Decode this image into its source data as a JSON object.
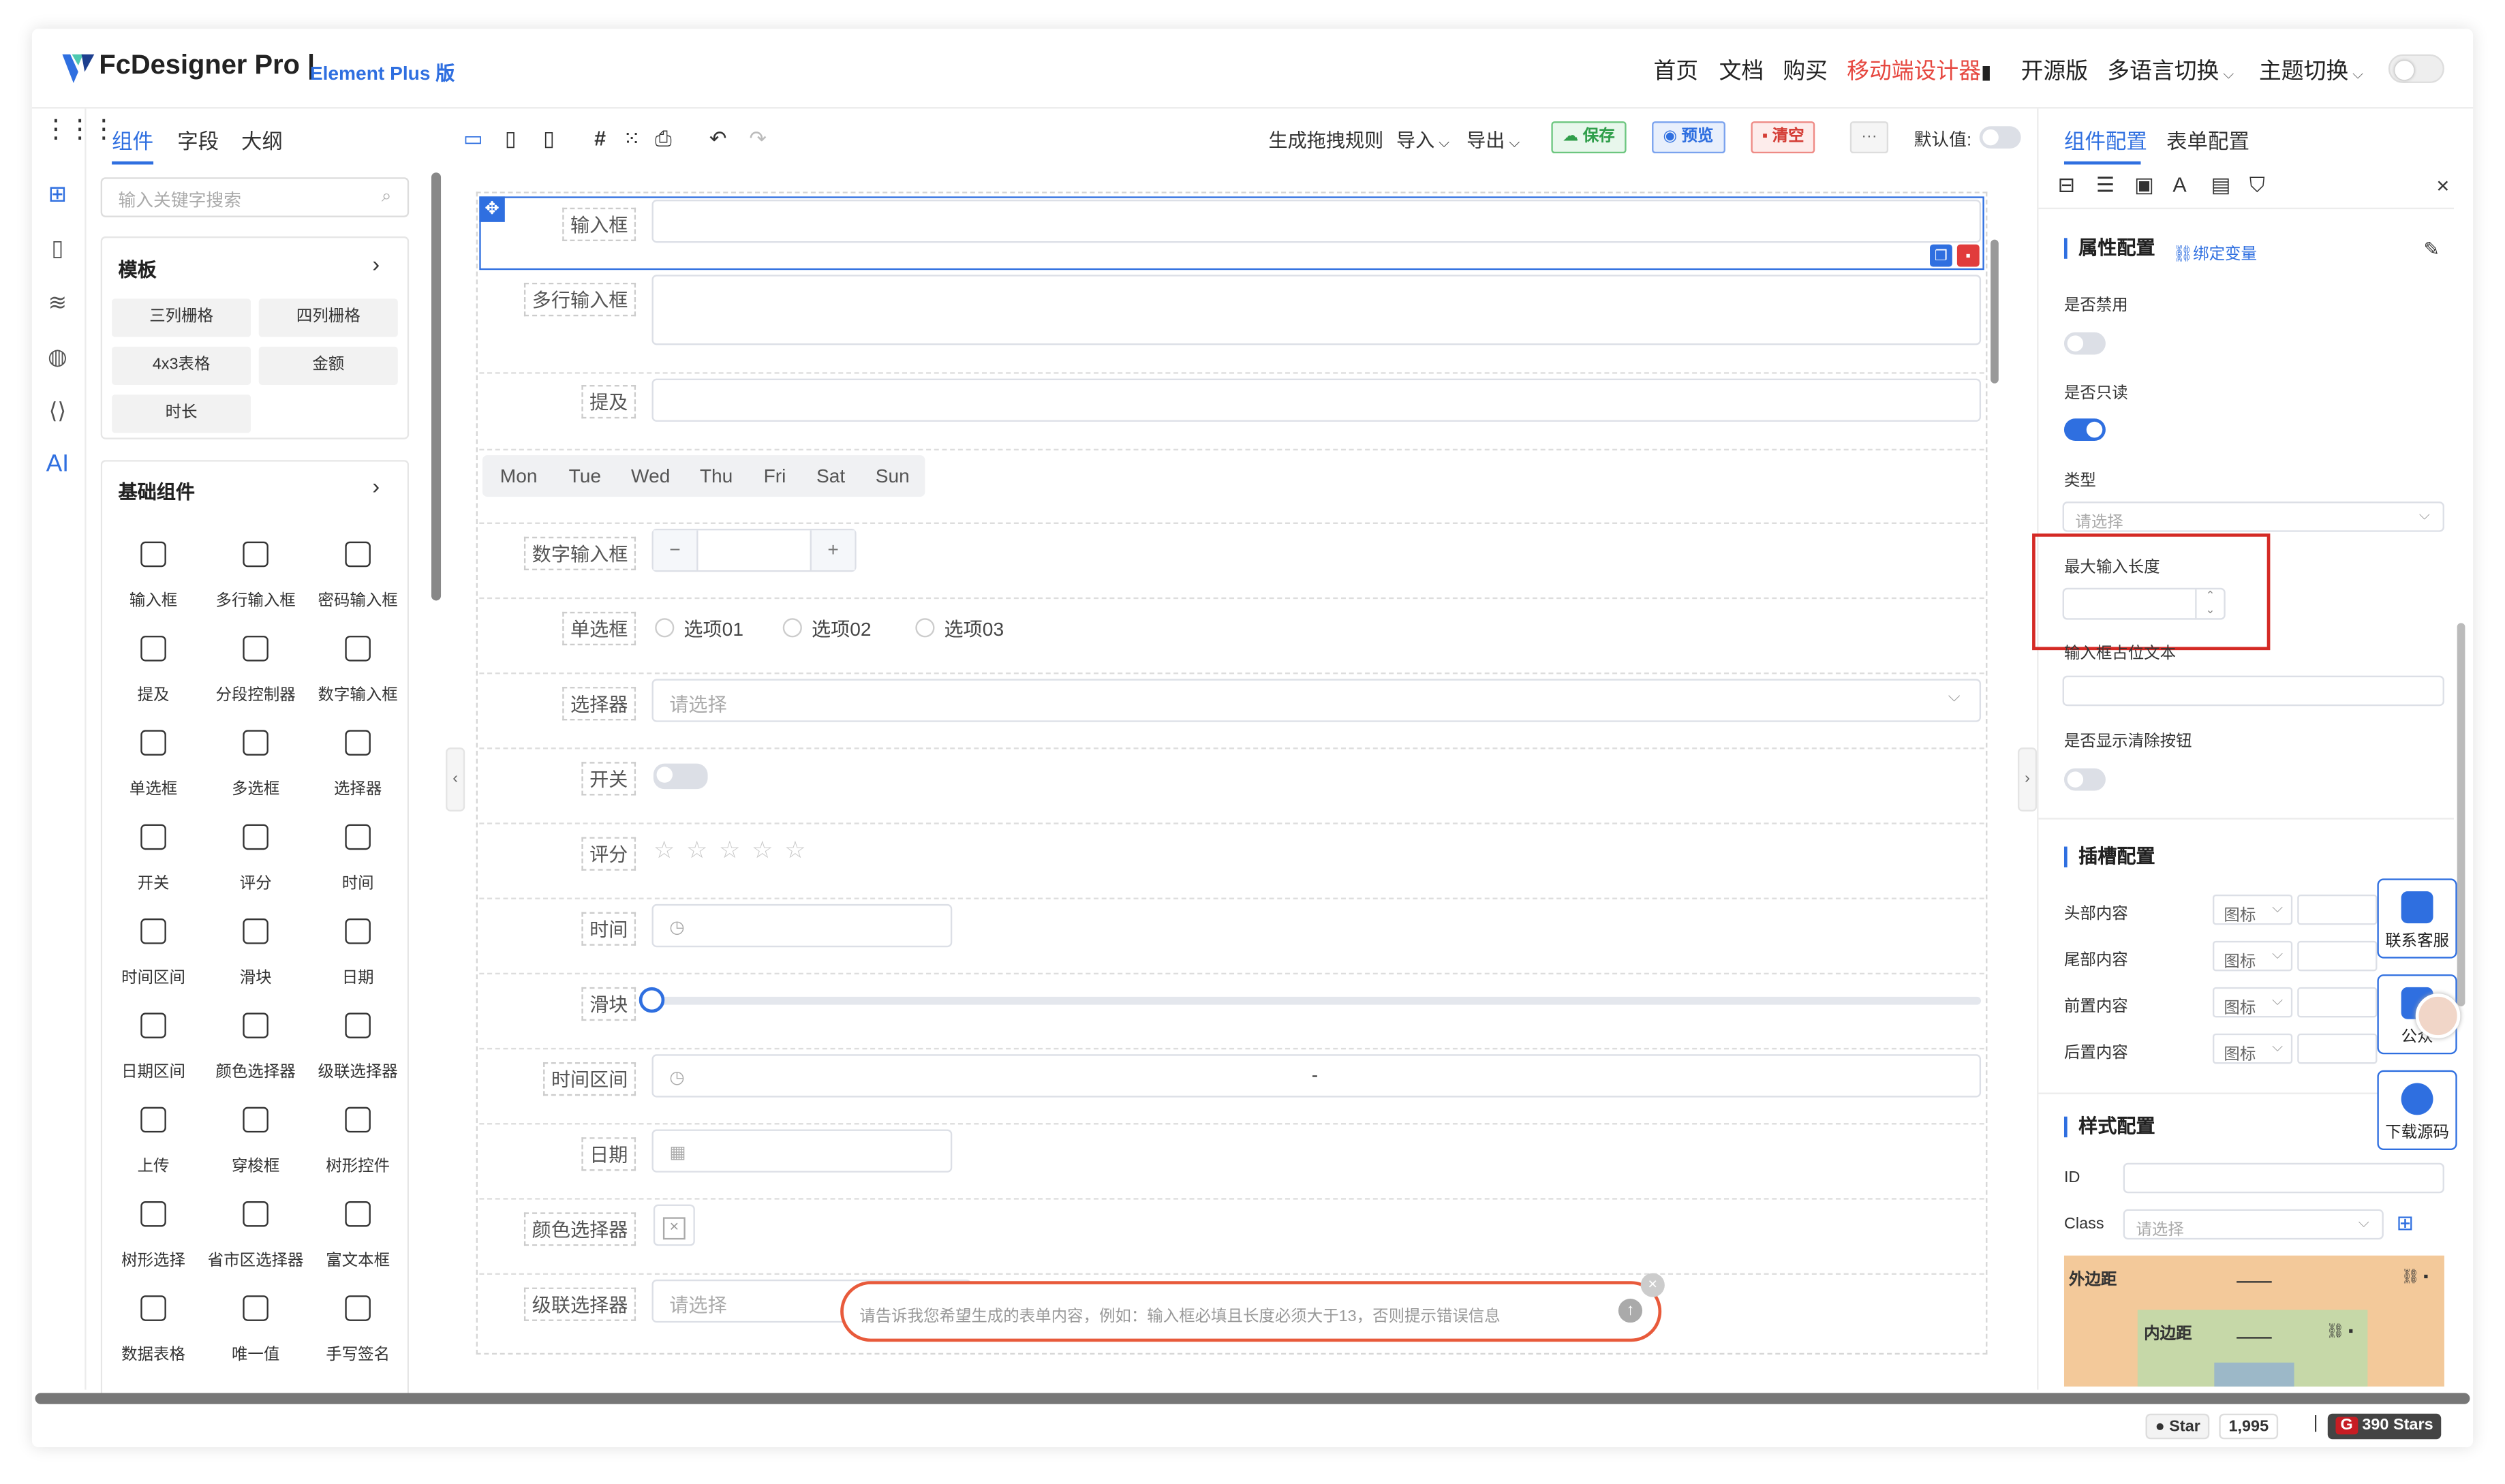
{
  "header": {
    "brand": "FcDesigner Pro |",
    "brand_sub": "Element Plus 版",
    "nav": [
      "首页",
      "文档",
      "购买",
      "移动端设计器",
      "开源版",
      "多语言切换",
      "主题切换"
    ],
    "nav_highlight": "#e6473f",
    "phone_glyph": "▮"
  },
  "left_panel": {
    "tabs": [
      "组件",
      "字段",
      "大纲"
    ],
    "search_placeholder": "输入关键字搜索",
    "templates_title": "模板",
    "templates": [
      "三列栅格",
      "四列栅格",
      "4x3表格",
      "金额",
      "时长"
    ],
    "basic_title": "基础组件",
    "components": [
      "输入框",
      "多行输入框",
      "密码输入框",
      "提及",
      "分段控制器",
      "数字输入框",
      "单选框",
      "多选框",
      "选择器",
      "开关",
      "评分",
      "时间",
      "时间区间",
      "滑块",
      "日期",
      "日期区间",
      "颜色选择器",
      "级联选择器",
      "上传",
      "穿梭框",
      "树形控件",
      "树形选择",
      "省市区选择器",
      "富文本框",
      "数据表格",
      "唯一值",
      "手写签名"
    ],
    "rail_ai": "AI"
  },
  "toolbar": {
    "rule": "生成拖拽规则",
    "import": "导入",
    "export": "导出",
    "save": "保存",
    "preview": "预览",
    "clear": "清空",
    "more": "···",
    "default_label": "默认值:"
  },
  "canvas": {
    "fields": {
      "input": "输入框",
      "textarea": "多行输入框",
      "mention": "提及",
      "number": "数字输入框",
      "radio": "单选框",
      "select": "选择器",
      "switch": "开关",
      "rate": "评分",
      "time": "时间",
      "slider": "滑块",
      "timerange": "时间区间",
      "date": "日期",
      "color": "颜色选择器",
      "cascader": "级联选择器"
    },
    "weekdays": [
      "Mon",
      "Tue",
      "Wed",
      "Thu",
      "Fri",
      "Sat",
      "Sun"
    ],
    "radio_options": [
      "选项01",
      "选项02",
      "选项03"
    ],
    "select_placeholder": "请选择",
    "cascader_placeholder": "请选择",
    "range_sep": "-",
    "rating_value": 0,
    "rating_max": 5,
    "slider_value": 0,
    "ai_prompt": "请告诉我您希望生成的表单内容，例如：输入框必填且长度必须大于13，否则提示错误信息"
  },
  "right_panel": {
    "tabs": [
      "组件配置",
      "表单配置"
    ],
    "attr_title": "属性配置",
    "bind_var": "绑定变量",
    "disabled": "是否禁用",
    "disabled_on": false,
    "readonly": "是否只读",
    "readonly_on": true,
    "type": "类型",
    "type_placeholder": "请选择",
    "maxlength": "最大输入长度",
    "placeholder": "输入框占位文本",
    "clearable": "是否显示清除按钮",
    "clearable_on": false,
    "slot_title": "插槽配置",
    "slots": [
      "头部内容",
      "尾部内容",
      "前置内容",
      "后置内容"
    ],
    "slot_value": "图标",
    "style_title": "样式配置",
    "id_label": "ID",
    "class_label": "Class",
    "class_placeholder": "请选择",
    "margin": "外边距",
    "padding": "内边距"
  },
  "float": {
    "service": "联系客服",
    "account": "公众",
    "download": "下载源码"
  },
  "status": {
    "star": "Star",
    "star_count": "1,995",
    "stars": "390 Stars",
    "sep": "|"
  }
}
